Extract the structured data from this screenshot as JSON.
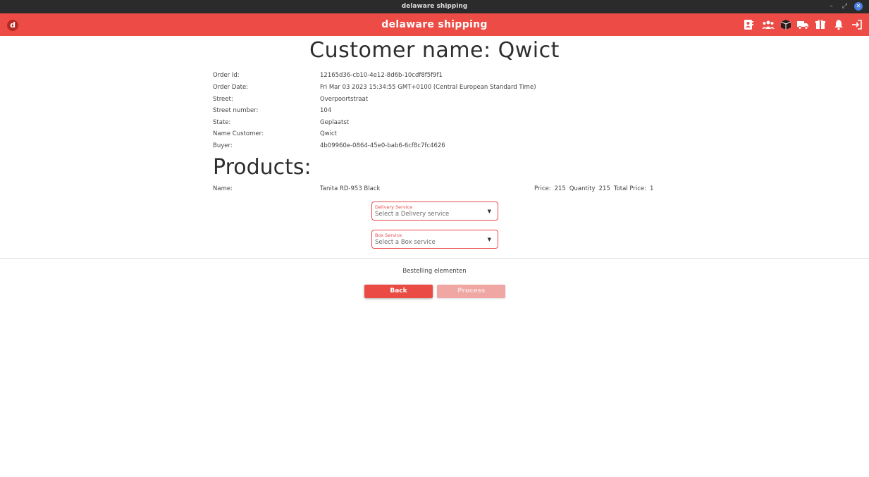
{
  "window": {
    "title": "delaware shipping"
  },
  "appbar": {
    "logo": "d",
    "title": "delaware shipping",
    "icons": [
      "contacts-icon",
      "users-icon",
      "box-icon",
      "truck-icon",
      "package-icon",
      "bell-icon",
      "logout-icon"
    ]
  },
  "page": {
    "heading": "Customer name: Qwict"
  },
  "order": {
    "rows": [
      {
        "label": "Order Id:",
        "value": "12165d36-cb10-4e12-8d6b-10cdf8f5f9f1"
      },
      {
        "label": "Order Date:",
        "value": "Fri Mar 03 2023 15:34:55 GMT+0100 (Central European Standard Time)"
      },
      {
        "label": "Street:",
        "value": "Overpoortstraat"
      },
      {
        "label": "Street number:",
        "value": "104"
      },
      {
        "label": "State:",
        "value": "Geplaatst"
      },
      {
        "label": "Name Customer:",
        "value": "Qwict"
      },
      {
        "label": "Buyer:",
        "value": "4b09960e-0864-45e0-bab6-6cf8c7fc4626"
      }
    ]
  },
  "products": {
    "heading": "Products:",
    "name_label": "Name:",
    "name": "Tanita RD-953 Black",
    "price_label": "Price:",
    "price": "215",
    "quantity_label": "Quantity",
    "quantity": "215",
    "total_label": "Total Price:",
    "total": "1"
  },
  "delivery_select": {
    "label": "Delivery Service",
    "placeholder": "Select a Delivery service"
  },
  "box_select": {
    "label": "Box Service",
    "placeholder": "Select a Box service"
  },
  "footer": {
    "text": "Bestelling elementen",
    "back_label": "Back",
    "process_label": "Process"
  }
}
